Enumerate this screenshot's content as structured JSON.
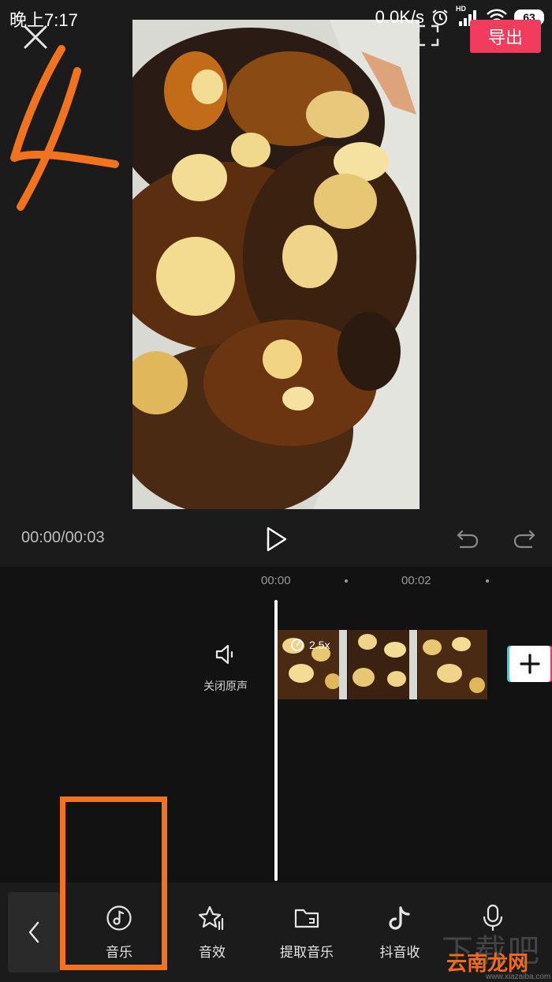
{
  "status_bar": {
    "time": "晚上7:17",
    "network_speed": "0.0K/s",
    "signal_tag": "HD",
    "battery": "63"
  },
  "header": {
    "export_label": "导出",
    "close_icon": "close-icon",
    "fullscreen_icon": "fullscreen-icon"
  },
  "annotation": {
    "step_number": "4",
    "color": "#f2731d"
  },
  "playback": {
    "timecode": "00:00/00:03",
    "play_icon": "play-icon",
    "undo_icon": "undo-icon",
    "redo_icon": "redo-icon"
  },
  "timeline": {
    "ruler_labels": [
      "00:00",
      "00:02"
    ],
    "mute_label": "关闭原声",
    "speed_label": "2.5x",
    "add_icon": "plus-icon"
  },
  "toolbar": {
    "back_icon": "chevron-left-icon",
    "items": [
      {
        "label": "音乐",
        "icon": "music-note-icon"
      },
      {
        "label": "音效",
        "icon": "sound-effect-star-icon"
      },
      {
        "label": "提取音乐",
        "icon": "folder-icon"
      },
      {
        "label": "抖音收",
        "icon": "tiktok-icon"
      },
      {
        "label": "",
        "icon": "microphone-icon"
      }
    ]
  },
  "watermark": {
    "big_text": "下载吧",
    "main_text": "云南龙网",
    "sub_text": "www.xiazaiba.com"
  },
  "colors": {
    "accent": "#f23c5e",
    "annotation": "#f2731d",
    "background": "#111111"
  }
}
